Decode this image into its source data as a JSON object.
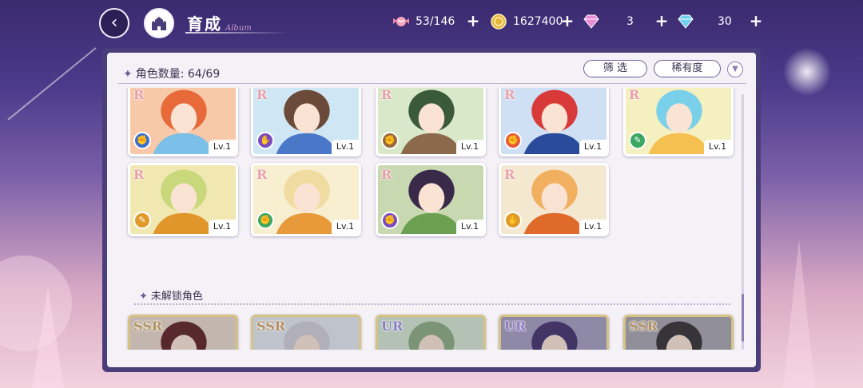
{
  "header": {
    "title": "育成",
    "title_script": "Album"
  },
  "resources": [
    {
      "icon": "candy-icon",
      "value": "53/146"
    },
    {
      "icon": "gold-coin-icon",
      "value": "1627400"
    },
    {
      "icon": "pink-diamond-icon",
      "value": "3"
    },
    {
      "icon": "blue-diamond-icon",
      "value": "30"
    }
  ],
  "panel": {
    "count_label": "角色数量: 64/69",
    "filter_label": "筛 选",
    "rarity_label": "稀有度",
    "unlocked_section": "未解锁角色"
  },
  "colors": {
    "panel_border": "#4a3e7a",
    "element_fire": "#e85a3a",
    "element_blue": "#3a6fd0",
    "element_purple": "#7a4cc0",
    "element_brown": "#9a6a3a",
    "element_green": "#3aa860",
    "element_orange": "#e09a2a"
  },
  "characters": [
    {
      "rarity": "R",
      "level": "Lv.1",
      "element": "blue",
      "glyph": "✊"
    },
    {
      "rarity": "R",
      "level": "Lv.1",
      "element": "purple",
      "glyph": "✋"
    },
    {
      "rarity": "R",
      "level": "Lv.1",
      "element": "brown",
      "glyph": "✊"
    },
    {
      "rarity": "R",
      "level": "Lv.1",
      "element": "fire",
      "glyph": "✊"
    },
    {
      "rarity": "R",
      "level": "Lv.1",
      "element": "green",
      "glyph": "✎"
    },
    {
      "rarity": "R",
      "level": "Lv.1",
      "element": "orange",
      "glyph": "✎"
    },
    {
      "rarity": "R",
      "level": "Lv.1",
      "element": "green",
      "glyph": "✊"
    },
    {
      "rarity": "R",
      "level": "Lv.1",
      "element": "purple",
      "glyph": "✊"
    },
    {
      "rarity": "R",
      "level": "Lv.1",
      "element": "orange",
      "glyph": "✋"
    }
  ],
  "locked_characters": [
    {
      "rarity": "SSR",
      "element": "brown",
      "glyph": "✎"
    },
    {
      "rarity": "SSR",
      "element": "blue",
      "glyph": "✋"
    },
    {
      "rarity": "UR",
      "element": "green",
      "glyph": "✋"
    },
    {
      "rarity": "UR",
      "element": "blue",
      "glyph": "✋"
    },
    {
      "rarity": "SSR",
      "element": "brown",
      "glyph": "✊"
    }
  ]
}
